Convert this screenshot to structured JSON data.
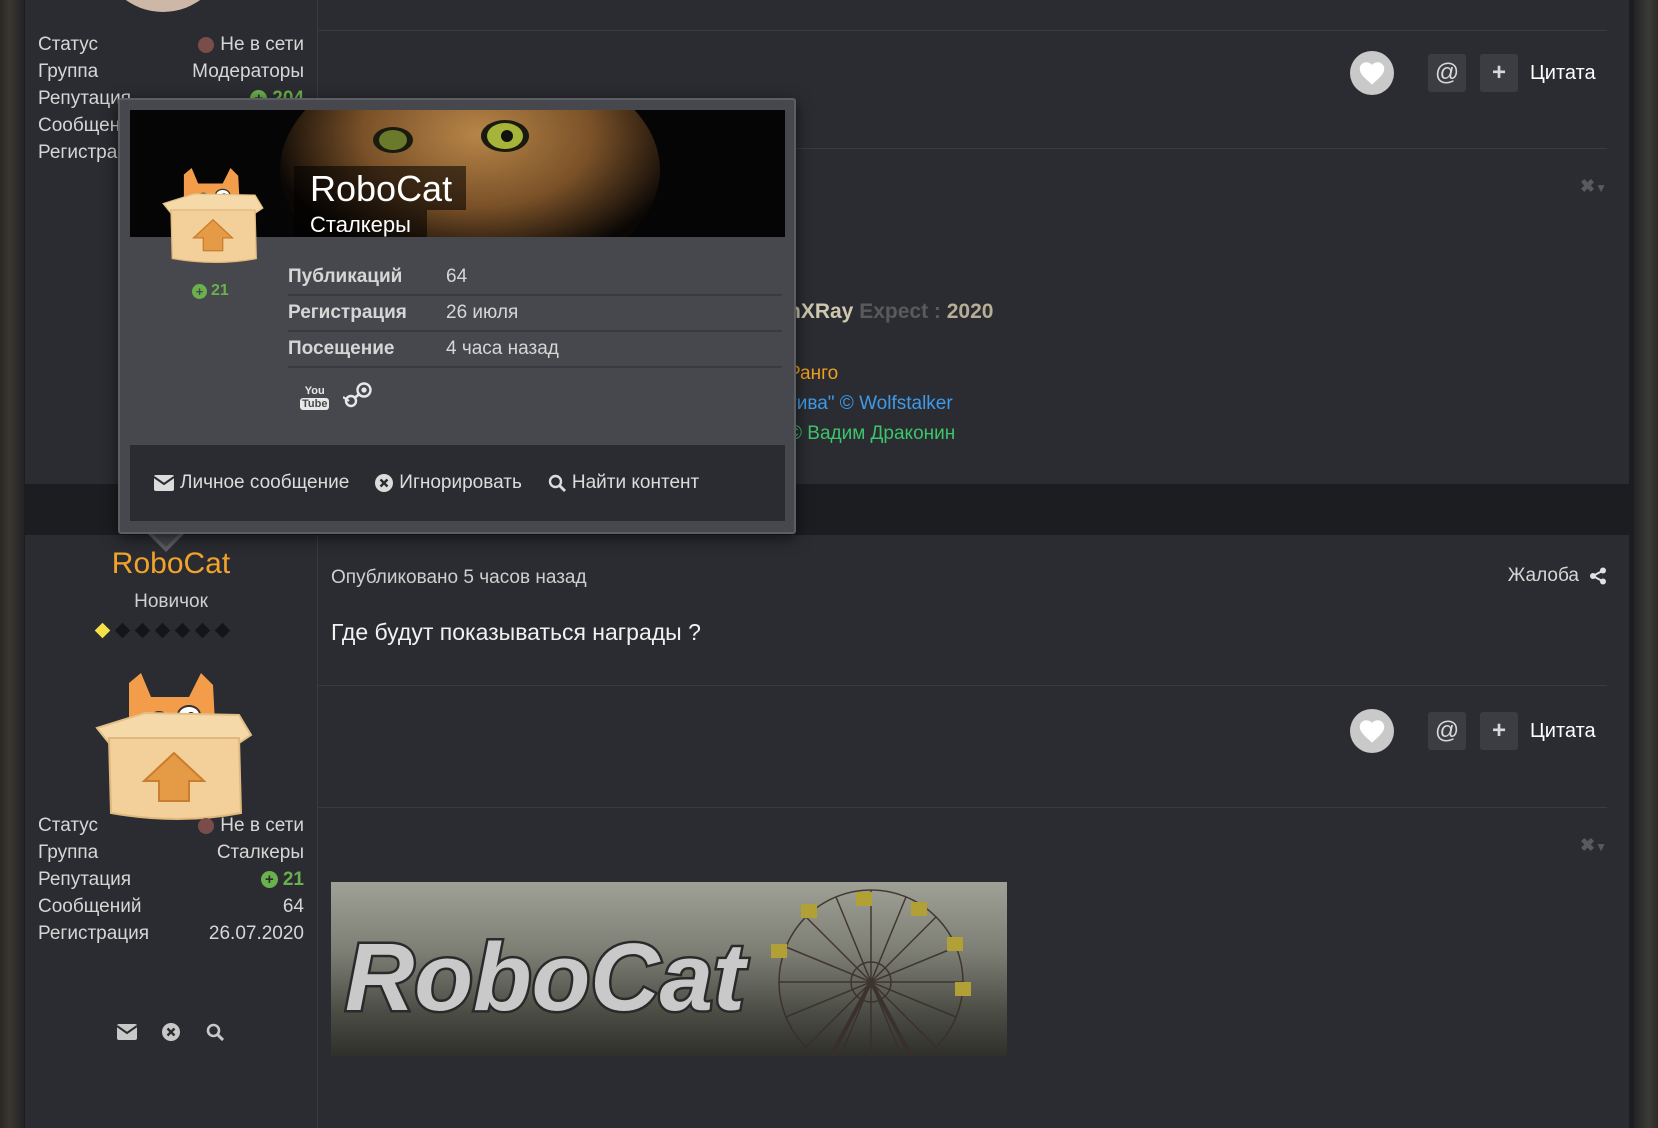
{
  "top_post": {
    "stats": [
      {
        "label": "Статус",
        "value": "Не в сети"
      },
      {
        "label": "Группа",
        "value": "Модераторы"
      },
      {
        "label": "Репутация",
        "value": "204"
      },
      {
        "label": "Сообщений",
        "value": ""
      },
      {
        "label": "Регистрация",
        "value": ""
      }
    ],
    "quote_label": "Цитата",
    "signature": {
      "line1_a": "nXRay",
      "line1_b": "Expect :",
      "line1_c": "2020",
      "line2": "Ранго",
      "line3": "тива\" © Wolfstalker",
      "line4": "© Вадим Драконин"
    }
  },
  "popup": {
    "name": "RoboCat",
    "group": "Сталкеры",
    "reputation": "21",
    "stats": [
      {
        "label": "Публикаций",
        "value": "64"
      },
      {
        "label": "Регистрация",
        "value": "26 июля"
      },
      {
        "label": "Посещение",
        "value": "4 часа назад"
      }
    ],
    "social_icons": [
      "youtube-icon",
      "steam-icon"
    ],
    "footer": {
      "message": "Личное сообщение",
      "ignore": "Игнорировать",
      "find": "Найти контент"
    }
  },
  "bottom_post": {
    "author": "RoboCat",
    "rank": "Новичок",
    "rank_pips_on": 1,
    "rank_pips_total": 7,
    "published": "Опубликовано 5 часов назад",
    "report": "Жалоба",
    "content": "Где будут показываться награды ?",
    "quote_label": "Цитата",
    "stats": [
      {
        "label": "Статус",
        "value": "Не в сети"
      },
      {
        "label": "Группа",
        "value": "Сталкеры"
      },
      {
        "label": "Репутация",
        "value": "21"
      },
      {
        "label": "Сообщений",
        "value": "64"
      },
      {
        "label": "Регистрация",
        "value": "26.07.2020"
      }
    ],
    "banner_text": "RoboCat"
  },
  "colors": {
    "accent_name": "#f2a32a",
    "rep_positive": "#6ab04c",
    "status_offline": "#7a4d4b",
    "sig_orange": "#f0a020",
    "sig_blue": "#3d9ae8",
    "sig_green": "#3cc46a"
  }
}
